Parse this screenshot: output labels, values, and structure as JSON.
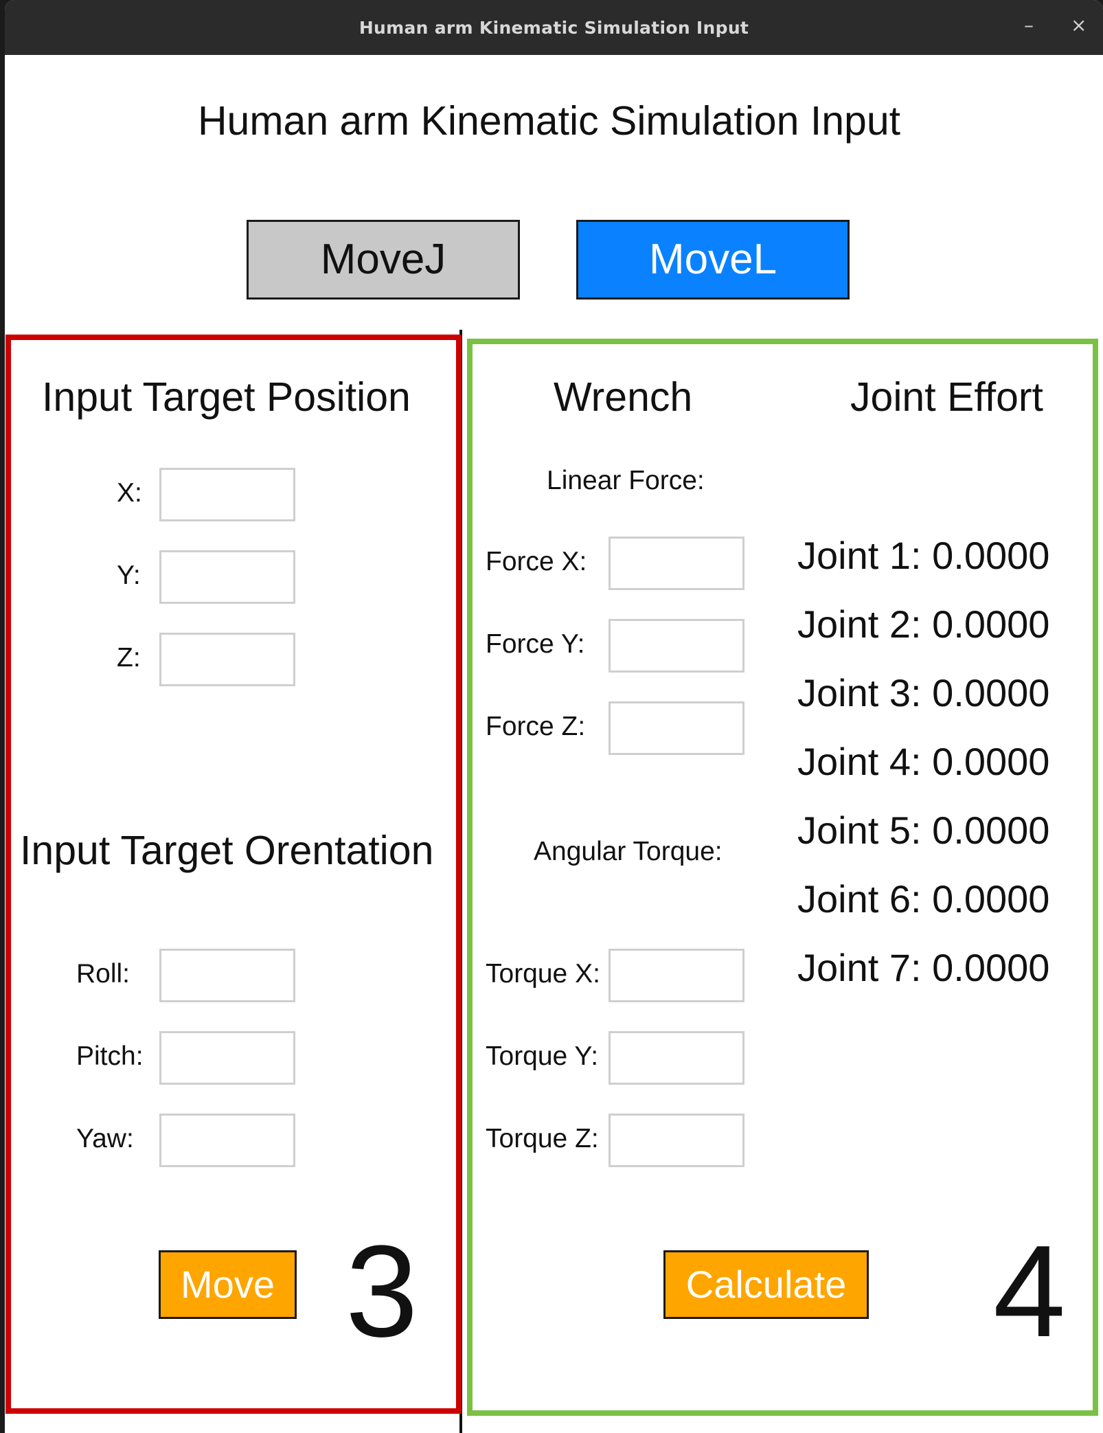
{
  "window": {
    "title": "Human arm Kinematic Simulation Input",
    "minimize": "–",
    "close": "×"
  },
  "header": {
    "title": "Human arm Kinematic Simulation Input"
  },
  "modes": {
    "movej": "MoveJ",
    "movel": "MoveL"
  },
  "colors": {
    "movel_active": "#0a82ff",
    "action_button": "#ffa500",
    "panel_left_border": "#cc0000",
    "panel_right_border": "#7ac143"
  },
  "left_panel": {
    "position_heading": "Input Target Position",
    "position_fields": [
      {
        "label": "X:",
        "value": ""
      },
      {
        "label": "Y:",
        "value": ""
      },
      {
        "label": "Z:",
        "value": ""
      }
    ],
    "orientation_heading": "Input Target Orentation",
    "orientation_fields": [
      {
        "label": "Roll:",
        "value": ""
      },
      {
        "label": "Pitch:",
        "value": ""
      },
      {
        "label": "Yaw:",
        "value": ""
      }
    ],
    "move_button": "Move",
    "marker": "3"
  },
  "right_panel": {
    "wrench_heading": "Wrench",
    "linear_force_label": "Linear Force:",
    "force_fields": [
      {
        "label": "Force X:",
        "value": ""
      },
      {
        "label": "Force Y:",
        "value": ""
      },
      {
        "label": "Force Z:",
        "value": ""
      }
    ],
    "angular_torque_label": "Angular Torque:",
    "torque_fields": [
      {
        "label": "Torque X:",
        "value": ""
      },
      {
        "label": "Torque Y:",
        "value": ""
      },
      {
        "label": "Torque Z:",
        "value": ""
      }
    ],
    "joint_effort_heading": "Joint Effort",
    "joints": [
      "Joint 1: 0.0000",
      "Joint 2: 0.0000",
      "Joint 3: 0.0000",
      "Joint 4: 0.0000",
      "Joint 5: 0.0000",
      "Joint 6: 0.0000",
      "Joint 7: 0.0000"
    ],
    "calculate_button": "Calculate",
    "marker": "4"
  }
}
